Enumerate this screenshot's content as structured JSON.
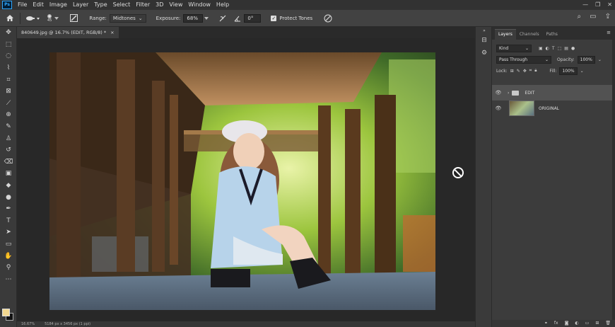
{
  "app": {
    "logo": "Ps"
  },
  "menu": [
    "File",
    "Edit",
    "Image",
    "Layer",
    "Type",
    "Select",
    "Filter",
    "3D",
    "View",
    "Window",
    "Help"
  ],
  "window_controls": [
    "—",
    "❐",
    "✕"
  ],
  "options": {
    "brush_size": "45",
    "range_label": "Range:",
    "range_value": "Midtones",
    "exposure_label": "Exposure:",
    "exposure_value": "68%",
    "angle_value": "0°",
    "protect_label": "Protect Tones"
  },
  "document": {
    "tab_title": "840649.jpg @ 16.7% (EDIT, RGB/8) *",
    "close": "×"
  },
  "status": {
    "zoom": "16.67%",
    "dims": "5184 px x 3456 px (1 ppi)"
  },
  "layers_panel": {
    "tabs": [
      "Layers",
      "Channels",
      "Paths"
    ],
    "kind_label": "Kind",
    "blend_mode": "Pass Through",
    "opacity_label": "Opacity:",
    "opacity_value": "100%",
    "lock_label": "Lock:",
    "fill_label": "Fill:",
    "fill_value": "100%",
    "layers": [
      {
        "name": "EDIT",
        "type": "group"
      },
      {
        "name": "ORIGINAL",
        "type": "image"
      }
    ]
  },
  "colors": {
    "foreground": "#f2d890",
    "background": "#111111"
  }
}
